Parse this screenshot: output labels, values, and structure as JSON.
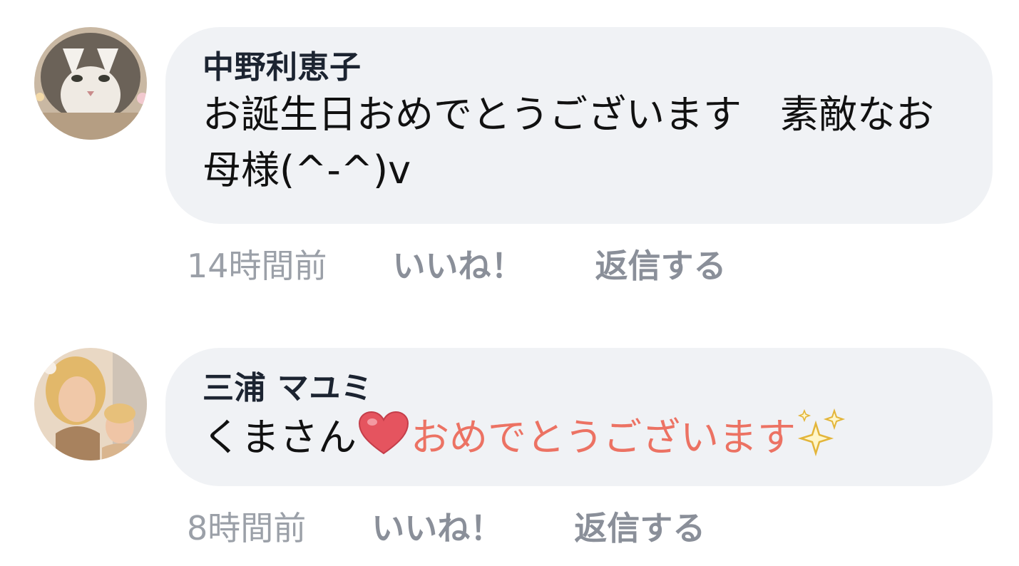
{
  "comments": [
    {
      "author": "中野利恵子",
      "text": "お誕生日おめでとうございます　素敵なお母様(^-^)v",
      "time": "14時間前",
      "like_label": "いいね！",
      "reply_label": "返信する",
      "avatar_icon": "cat-avatar"
    },
    {
      "author": "三浦 マユミ",
      "text_prefix": "くまさん",
      "text_accent": "おめでとうございます",
      "heart_icon": "red-heart-icon",
      "sparkles_icon": "sparkles-icon",
      "accent_color": "#ec7263",
      "time": "8時間前",
      "like_label": "いいね！",
      "reply_label": "返信する",
      "avatar_icon": "person-avatar"
    }
  ]
}
